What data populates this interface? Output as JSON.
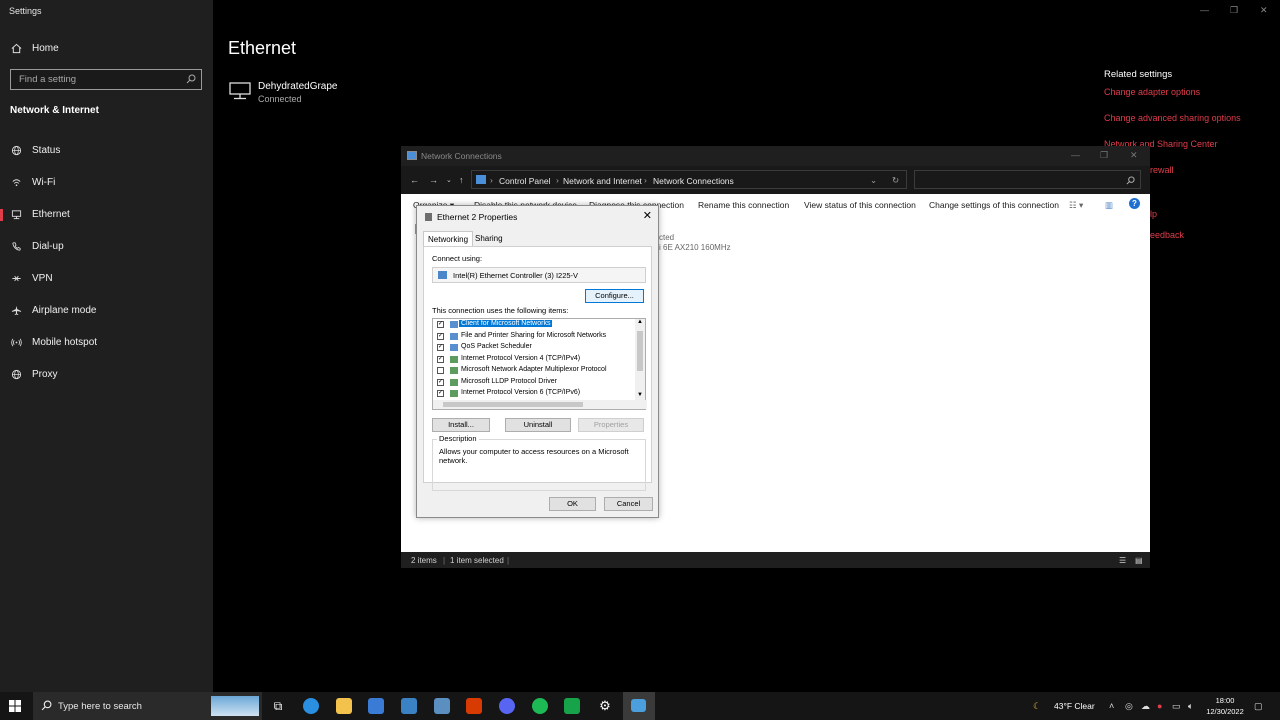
{
  "settings": {
    "app_title": "Settings",
    "home": "Home",
    "search_placeholder": "Find a setting",
    "section": "Network & Internet",
    "nav": [
      "Status",
      "Wi-Fi",
      "Ethernet",
      "Dial-up",
      "VPN",
      "Airplane mode",
      "Mobile hotspot",
      "Proxy"
    ],
    "active_item": "Ethernet"
  },
  "main": {
    "title": "Ethernet",
    "network_name": "DehydratedGrape",
    "network_status": "Connected",
    "related_head": "Related settings",
    "related_links": [
      "Change adapter options",
      "Change advanced sharing options",
      "Network and Sharing Center"
    ],
    "partial_links": [
      "rewall",
      "lp",
      "eedback"
    ]
  },
  "network_connections": {
    "title": "Network Connections",
    "breadcrumb": [
      "Control Panel",
      "Network and Internet",
      "Network Connections"
    ],
    "toolbar": [
      "Organize ▾",
      "Disable this network device",
      "Diagnose this connection",
      "Rename this connection",
      "View status of this connection",
      "Change settings of this connection"
    ],
    "partial_status": "cted",
    "partial_adapter": "i 6E AX210 160MHz",
    "status_items": "2 items",
    "status_selected": "1 item selected"
  },
  "dialog": {
    "title": "Ethernet 2 Properties",
    "tabs": [
      "Networking",
      "Sharing"
    ],
    "connect_using_label": "Connect using:",
    "adapter": "Intel(R) Ethernet Controller (3) I225-V",
    "configure": "Configure...",
    "items_label": "This connection uses the following items:",
    "items": [
      {
        "label": "Client for Microsoft Networks",
        "checked": true
      },
      {
        "label": "File and Printer Sharing for Microsoft Networks",
        "checked": true
      },
      {
        "label": "QoS Packet Scheduler",
        "checked": true
      },
      {
        "label": "Internet Protocol Version 4 (TCP/IPv4)",
        "checked": true
      },
      {
        "label": "Microsoft Network Adapter Multiplexor Protocol",
        "checked": false
      },
      {
        "label": "Microsoft LLDP Protocol Driver",
        "checked": true
      },
      {
        "label": "Internet Protocol Version 6 (TCP/IPv6)",
        "checked": true
      }
    ],
    "install": "Install...",
    "uninstall": "Uninstall",
    "properties": "Properties",
    "description_label": "Description",
    "description": "Allows your computer to access resources on a Microsoft network.",
    "ok": "OK",
    "cancel": "Cancel"
  },
  "taskbar": {
    "search": "Type here to search",
    "weather": "43°F  Clear",
    "time": "18:00",
    "date": "12/30/2022"
  }
}
